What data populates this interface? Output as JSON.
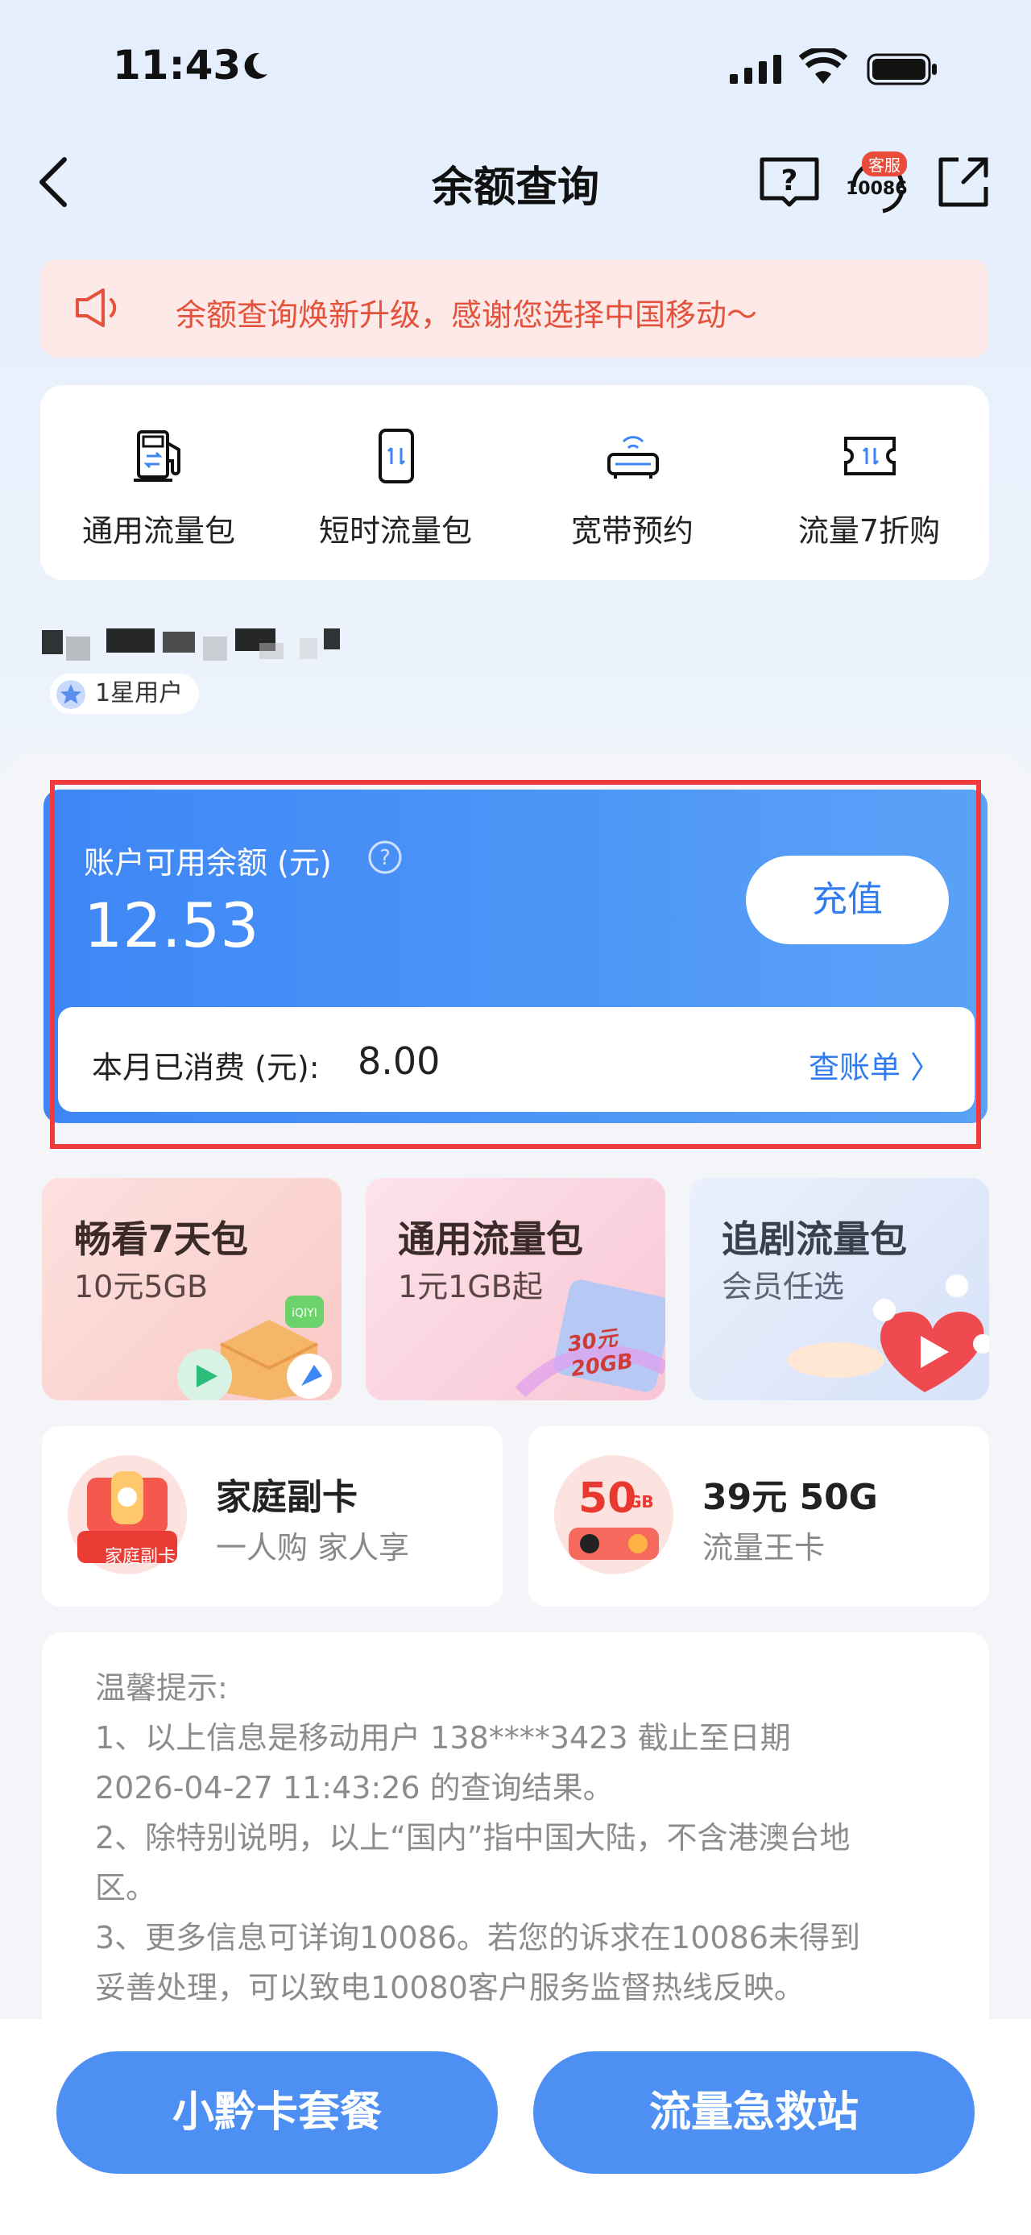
{
  "status_bar": {
    "time": "11:43"
  },
  "nav": {
    "title": "余额查询",
    "cs_badge": "客服",
    "cs_number": "10086"
  },
  "notice": {
    "text": "余额查询焕新升级，感谢您选择中国移动～"
  },
  "quick_services": [
    {
      "label": "通用流量包",
      "icon": "fuel-pump-icon"
    },
    {
      "label": "短时流量包",
      "icon": "phone-data-icon"
    },
    {
      "label": "宽带预约",
      "icon": "router-icon"
    },
    {
      "label": "流量7折购",
      "icon": "ticket-icon"
    }
  ],
  "user": {
    "level": "1星用户"
  },
  "balance": {
    "label": "账户可用余额 (元)",
    "value": "12.53",
    "recharge_label": "充值",
    "spent_label": "本月已消费 (元):",
    "spent_value": "8.00",
    "bill_link": "查账单 〉"
  },
  "promos": [
    {
      "title": "畅看7天包",
      "subtitle": "10元5GB"
    },
    {
      "title": "通用流量包",
      "subtitle": "1元1GB起",
      "tag": "30元20GB"
    },
    {
      "title": "追剧流量包",
      "subtitle": "会员任选"
    }
  ],
  "offers": [
    {
      "title": "家庭副卡",
      "subtitle": "一人购 家人享",
      "badge": "家庭副卡"
    },
    {
      "title": "39元 50G",
      "subtitle": "流量王卡",
      "badge_num": "50",
      "badge_unit": "GB"
    }
  ],
  "tips": {
    "lines": [
      "温馨提示:",
      "1、以上信息是移动用户 138****3423 截止至日期",
      "2026-04-27 11:43:26 的查询结果。",
      "2、除特别说明，以上“国内”指中国大陆，不含港澳台地",
      "区。",
      "3、更多信息可详询10086。若您的诉求在10086未得到",
      "妥善处理，可以致电10080客户服务监督热线反映。"
    ]
  },
  "bottom_buttons": [
    "小黔卡套餐",
    "流量急救站"
  ],
  "colors": {
    "accent": "#3e86f5",
    "notice_text": "#e4523b",
    "highlight": "#ef3b3b"
  }
}
